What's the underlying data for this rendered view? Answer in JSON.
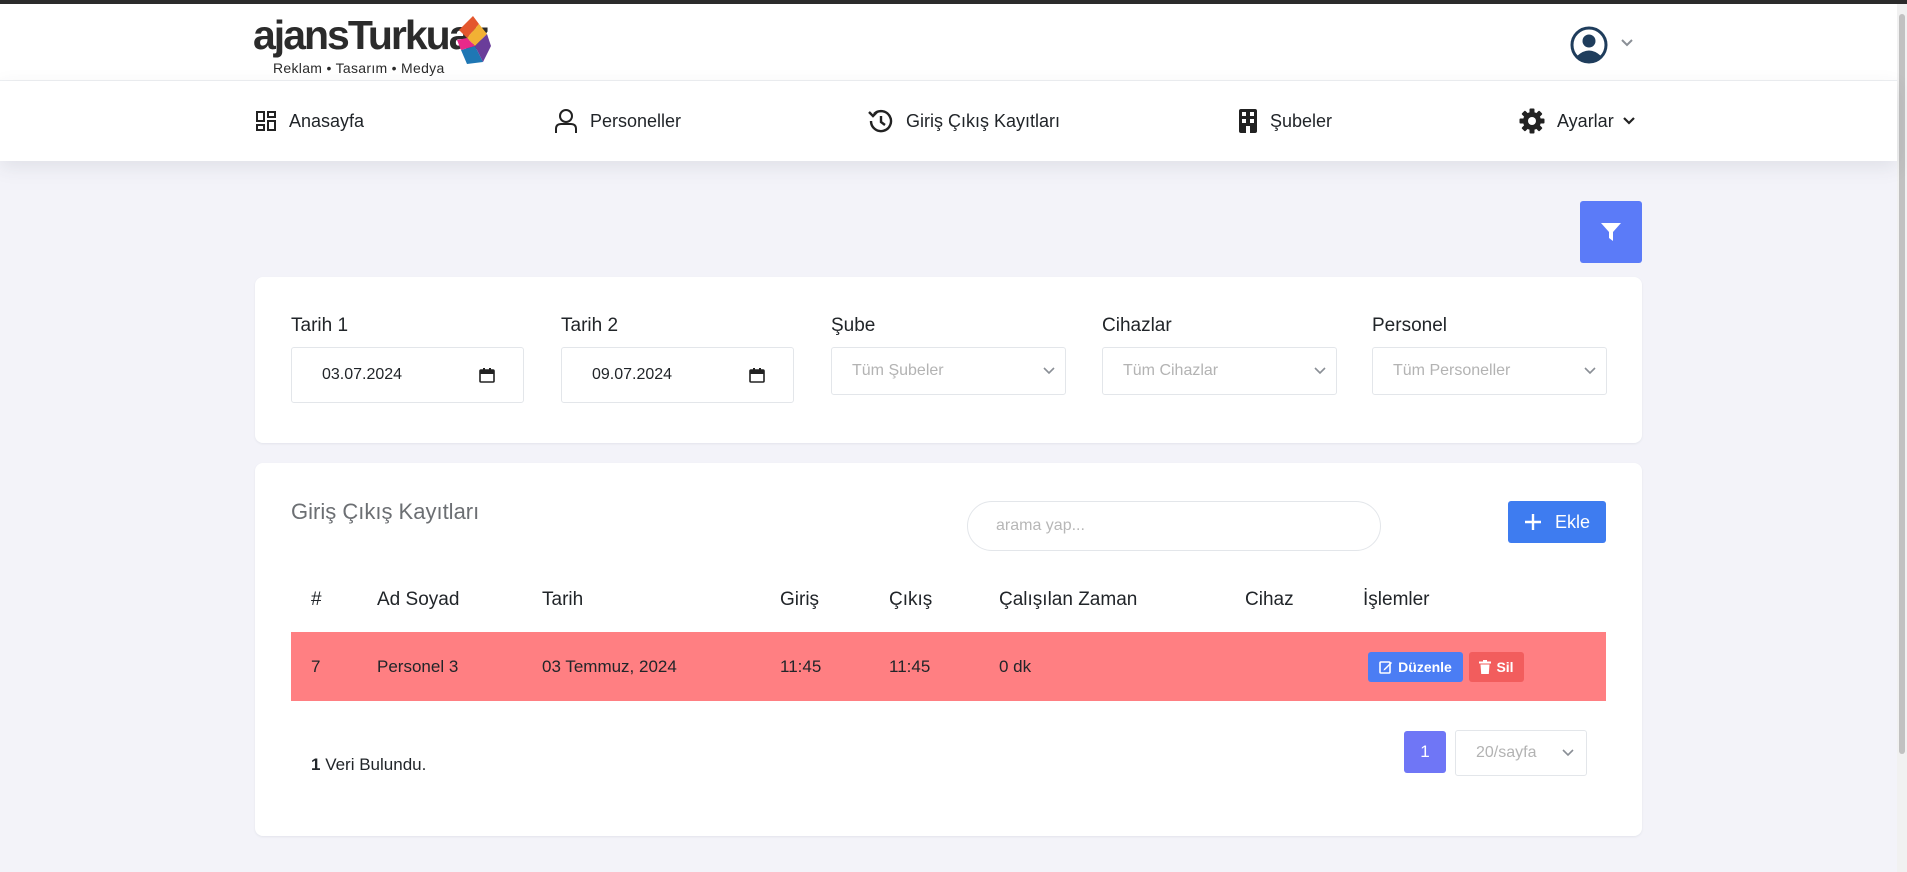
{
  "brand": {
    "logo_text": "ajansTurkuaz",
    "tagline": "Reklam • Tasarım • Medya"
  },
  "nav": {
    "items": [
      {
        "label": "Anasayfa",
        "icon": "dashboard-icon"
      },
      {
        "label": "Personeller",
        "icon": "user-icon"
      },
      {
        "label": "Giriş Çıkış Kayıtları",
        "icon": "history-icon"
      },
      {
        "label": "Şubeler",
        "icon": "building-icon"
      },
      {
        "label": "Ayarlar",
        "icon": "gear-icon"
      }
    ]
  },
  "filters": {
    "date1": {
      "label": "Tarih 1",
      "value": "03.07.2024"
    },
    "date2": {
      "label": "Tarih 2",
      "value": "09.07.2024"
    },
    "branch": {
      "label": "Şube",
      "value": "Tüm Şubeler"
    },
    "devices": {
      "label": "Cihazlar",
      "value": "Tüm Cihazlar"
    },
    "personnel": {
      "label": "Personel",
      "value": "Tüm Personeller"
    }
  },
  "records": {
    "title": "Giriş Çıkış Kayıtları",
    "search_placeholder": "arama yap...",
    "add_label": "Ekle",
    "columns": [
      "#",
      "Ad Soyad",
      "Tarih",
      "Giriş",
      "Çıkış",
      "Çalışılan Zaman",
      "Cihaz",
      "İşlemler"
    ],
    "rows": [
      {
        "id": "7",
        "name": "Personel 3",
        "date": "03 Temmuz, 2024",
        "in": "11:45",
        "out": "11:45",
        "worked": "0 dk",
        "device": "",
        "edit_label": "Düzenle",
        "delete_label": "Sil"
      }
    ],
    "found_count": "1",
    "found_text": " Veri Bulundu.",
    "page": "1",
    "page_size": "20/sayfa"
  },
  "colors": {
    "primary": "#5b7bf8",
    "row_highlight": "#ff7f82",
    "danger": "#f25d5d",
    "page_active": "#6f76f6"
  }
}
